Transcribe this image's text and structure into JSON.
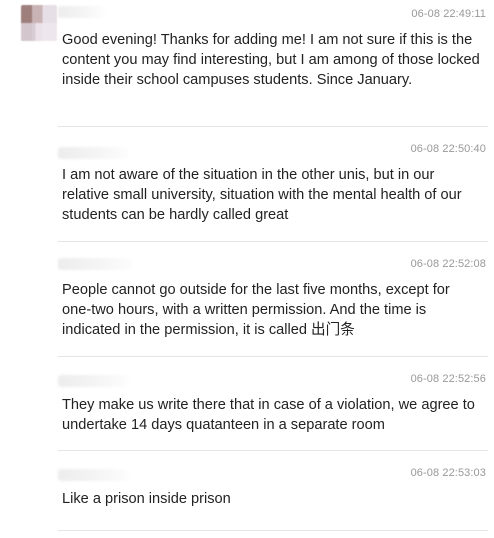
{
  "messages": [
    {
      "time": "06-08 22:49:11",
      "text": "Good evening! Thanks for adding me! I am not sure if this is the content you may find interesting, but I am among of those locked inside their school campuses students. Since January."
    },
    {
      "time": "06-08 22:50:40",
      "text": "I am not aware of the situation in the other unis, but in our relative small university, situation with the mental health of our students can be hardly called great"
    },
    {
      "time": "06-08 22:52:08",
      "text": "People cannot go outside for the last five months, except for one-two hours, with a written permission. And the time is indicated in the permission, it is called  出门条"
    },
    {
      "time": "06-08 22:52:56",
      "text": "They make us write there that in case of a violation, we agree to undertake 14 days quatanteen in a separate room"
    },
    {
      "time": "06-08 22:53:03",
      "text": "Like a prison inside prison"
    }
  ],
  "colors": {
    "text": "#222222",
    "timestamp": "#999999",
    "divider": "#e5e5e5"
  }
}
